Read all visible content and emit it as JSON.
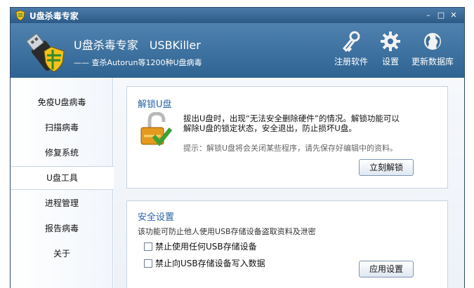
{
  "window": {
    "title": "U盘杀毒专家",
    "controls": {
      "minimize": "–",
      "maximize": "□",
      "close": "✕"
    }
  },
  "header": {
    "title": "U盘杀毒专家　USBKiller",
    "subtitle": "—— 查杀Autorun等1200种U盘病毒",
    "tools": [
      {
        "label": "注册软件",
        "icon": "key-icon"
      },
      {
        "label": "设置",
        "icon": "gear-icon"
      },
      {
        "label": "更新数据库",
        "icon": "globe-icon"
      }
    ]
  },
  "sidebar": {
    "items": [
      {
        "label": "免疫U盘病毒"
      },
      {
        "label": "扫描病毒"
      },
      {
        "label": "修复系统"
      },
      {
        "label": "U盘工具",
        "active": true
      },
      {
        "label": "进程管理"
      },
      {
        "label": "报告病毒"
      },
      {
        "label": "关于"
      }
    ]
  },
  "unlock_panel": {
    "title": "解锁U盘",
    "desc_line1": "拔出U盘时，出现“无法安全删除硬件”的情况。解锁功能可以",
    "desc_line2": "解除U盘的锁定状态，安全退出，防止损坏U盘。",
    "hint": "提示：解锁U盘将会关闭某些程序，请先保存好编辑中的资料。",
    "button": "立刻解锁"
  },
  "security_panel": {
    "title": "安全设置",
    "desc": "该功能可防止他人使用USB存储设备盗取资料及泄密",
    "option1": "禁止使用任何USB存储设备",
    "option2": "禁止向USB存储设备写入数据",
    "button": "应用设置"
  },
  "colors": {
    "header_top": "#4f82af",
    "header_bottom": "#2f6391",
    "panel_title": "#2a63a6"
  }
}
